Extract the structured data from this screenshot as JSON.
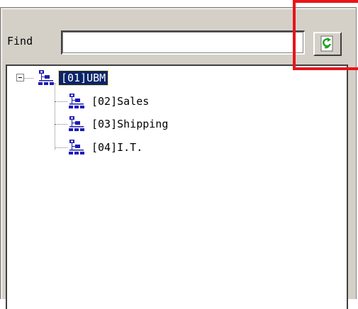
{
  "find": {
    "label": "Find",
    "value": "",
    "placeholder": ""
  },
  "refresh_button": {
    "icon": "refresh-icon"
  },
  "tree": {
    "root": {
      "label": "[01]UBM",
      "selected": true,
      "expanded": true,
      "icon": "org-chart-icon"
    },
    "children": [
      {
        "label": "[02]Sales",
        "icon": "org-chart-icon"
      },
      {
        "label": "[03]Shipping",
        "icon": "org-chart-icon"
      },
      {
        "label": "[04]I.T.",
        "icon": "org-chart-icon"
      }
    ]
  },
  "colors": {
    "selection": "#0a246a",
    "icon": "#1c1cb4",
    "highlight": "#e8141a",
    "panel": "#d4d0c8"
  }
}
